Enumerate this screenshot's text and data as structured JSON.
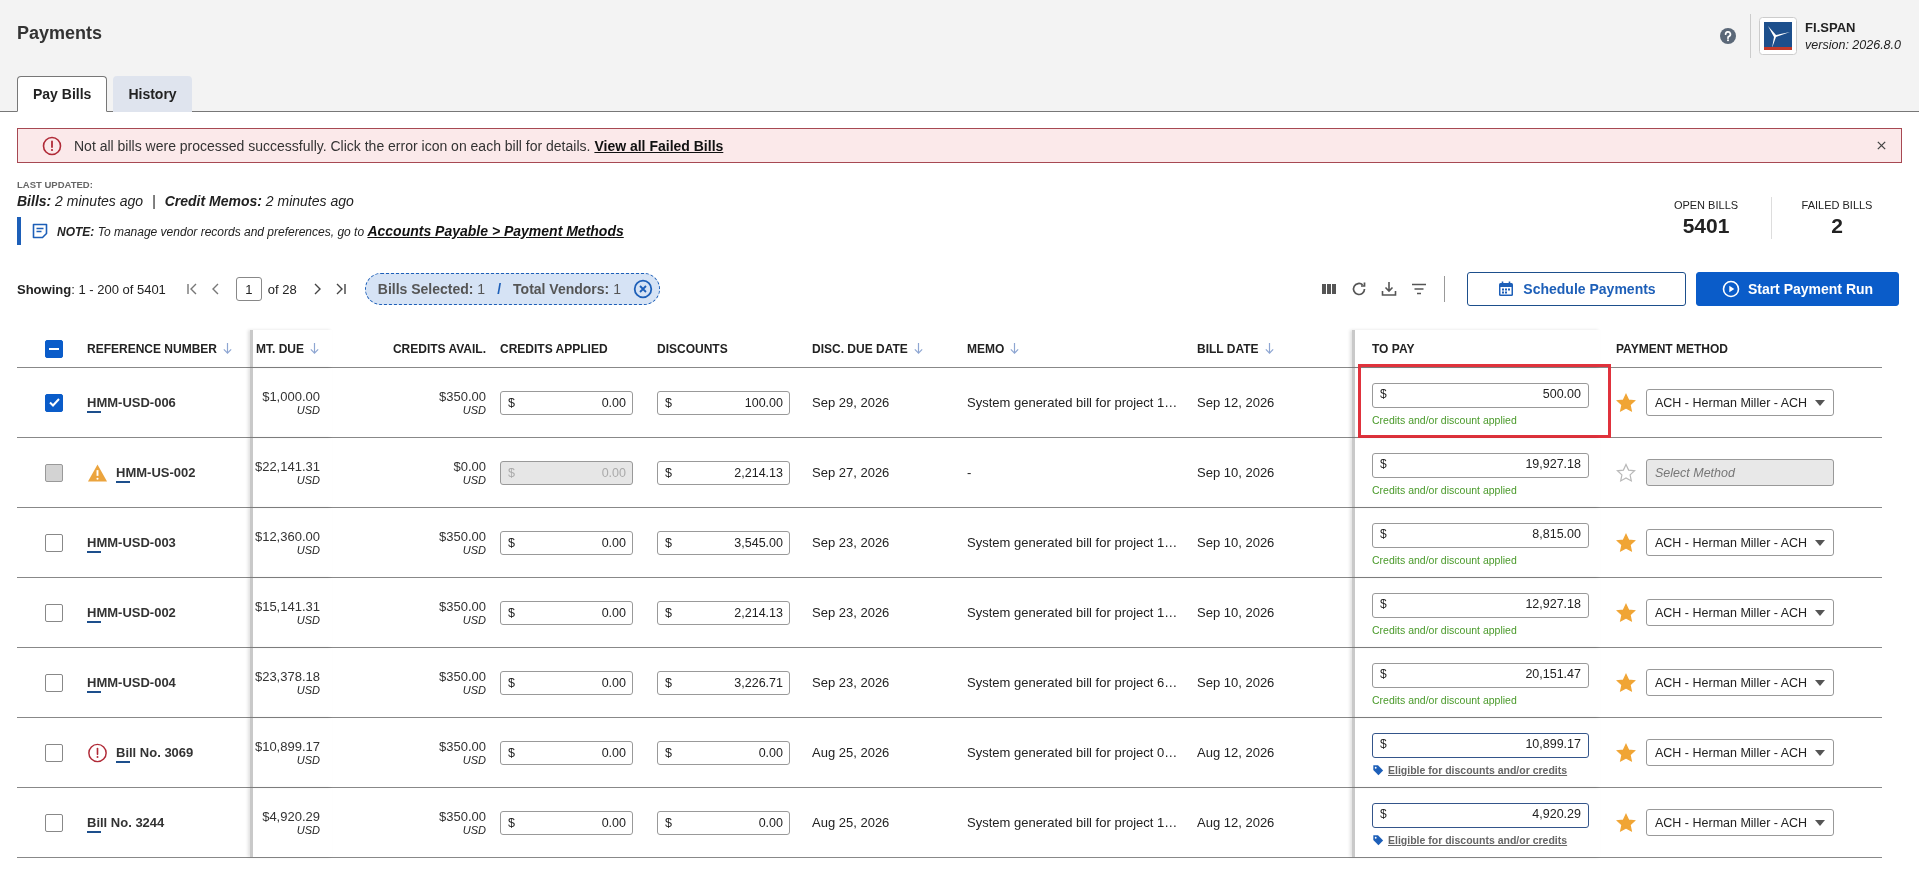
{
  "header": {
    "title": "Payments",
    "brand": {
      "name": "FI.SPAN",
      "version": "version: 2026.8.0"
    }
  },
  "tabs": [
    {
      "label": "Pay Bills",
      "selected": true
    },
    {
      "label": "History",
      "selected": false
    }
  ],
  "alert": {
    "message": "Not all bills were processed successfully. Click the error icon on each bill for details.",
    "link": "View all Failed Bills"
  },
  "last_updated": {
    "label": "LAST UPDATED:",
    "items": [
      {
        "label": "Bills:",
        "value": "2 minutes ago"
      },
      {
        "label": "Credit Memos:",
        "value": "2 minutes ago"
      }
    ],
    "separator": "|"
  },
  "note": {
    "label": "NOTE:",
    "text": "To manage vendor records and preferences, go to",
    "link": "Accounts Payable > Payment Methods"
  },
  "stats": [
    {
      "label": "OPEN BILLS",
      "value": "5401"
    },
    {
      "label": "FAILED BILLS",
      "value": "2"
    }
  ],
  "pagination": {
    "showing": "**Showing**: 1 - 200 of 5401",
    "page": "1",
    "of": "of 28"
  },
  "selection": {
    "items": [
      {
        "label": "Bills Selected:",
        "value": "1"
      },
      {
        "label": "Total Vendors:",
        "value": "1"
      }
    ],
    "separator": "/"
  },
  "actions": [
    {
      "label": "Schedule Payments",
      "kind": "secondary"
    },
    {
      "label": "Start Payment Run",
      "kind": "primary"
    }
  ],
  "table": {
    "select_all": {
      "indeterminate": true
    },
    "columns": [
      {
        "label": "REFERENCE NUMBER",
        "sortable": true
      },
      {
        "label": "MT. DUE",
        "sortable": true
      },
      {
        "label": "CREDITS AVAIL.",
        "sortable": false
      },
      {
        "label": "CREDITS APPLIED",
        "sortable": false
      },
      {
        "label": "DISCOUNTS",
        "sortable": false
      },
      {
        "label": "DISC. DUE DATE",
        "sortable": true
      },
      {
        "label": "MEMO",
        "sortable": true
      },
      {
        "label": "BILL DATE",
        "sortable": true
      },
      {
        "label": "TO PAY",
        "sortable": false
      },
      {
        "label": "PAYMENT METHOD",
        "sortable": false
      }
    ],
    "rows": [
      {
        "selected": true,
        "checkbox_disabled": false,
        "warning": false,
        "failed": false,
        "reference": "HMM-USD-006",
        "amount_due": "$1,000.00",
        "amount_currency": "USD",
        "credits_available": "$350.00",
        "credits_currency": "USD",
        "credits_applied": {
          "prefix": "$",
          "value": "0.00",
          "disabled": false
        },
        "discount": {
          "prefix": "$",
          "value": "100.00"
        },
        "disc_due_date": "Sep 29, 2026",
        "memo": "System generated bill for project 1…",
        "bill_date": "Sep 12, 2026",
        "to_pay": {
          "prefix": "$",
          "value": "500.00"
        },
        "to_pay_note": {
          "kind": "applied",
          "text": "Credits and/or discount applied"
        },
        "highlighted": true,
        "payment_method": {
          "favorite": true,
          "value": "ACH - Herman Miller - ACH",
          "disabled": false
        }
      },
      {
        "selected": false,
        "checkbox_disabled": true,
        "warning": true,
        "failed": false,
        "reference": "HMM-US-002",
        "amount_due": "$22,141.31",
        "amount_currency": "USD",
        "credits_available": "$0.00",
        "credits_currency": "USD",
        "credits_applied": {
          "prefix": "$",
          "value": "0.00",
          "disabled": true
        },
        "discount": {
          "prefix": "$",
          "value": "2,214.13"
        },
        "disc_due_date": "Sep 27, 2026",
        "memo": "-",
        "bill_date": "Sep 10, 2026",
        "to_pay": {
          "prefix": "$",
          "value": "19,927.18"
        },
        "to_pay_note": {
          "kind": "applied",
          "text": "Credits and/or discount applied"
        },
        "highlighted": false,
        "payment_method": {
          "favorite": false,
          "placeholder": "Select Method",
          "disabled": true
        }
      },
      {
        "selected": false,
        "checkbox_disabled": false,
        "warning": false,
        "failed": false,
        "reference": "HMM-USD-003",
        "amount_due": "$12,360.00",
        "amount_currency": "USD",
        "credits_available": "$350.00",
        "credits_currency": "USD",
        "credits_applied": {
          "prefix": "$",
          "value": "0.00",
          "disabled": false
        },
        "discount": {
          "prefix": "$",
          "value": "3,545.00"
        },
        "disc_due_date": "Sep 23, 2026",
        "memo": "System generated bill for project 1…",
        "bill_date": "Sep 10, 2026",
        "to_pay": {
          "prefix": "$",
          "value": "8,815.00"
        },
        "to_pay_note": {
          "kind": "applied",
          "text": "Credits and/or discount applied"
        },
        "highlighted": false,
        "payment_method": {
          "favorite": true,
          "value": "ACH - Herman Miller - ACH",
          "disabled": false
        }
      },
      {
        "selected": false,
        "checkbox_disabled": false,
        "warning": false,
        "failed": false,
        "reference": "HMM-USD-002",
        "amount_due": "$15,141.31",
        "amount_currency": "USD",
        "credits_available": "$350.00",
        "credits_currency": "USD",
        "credits_applied": {
          "prefix": "$",
          "value": "0.00",
          "disabled": false
        },
        "discount": {
          "prefix": "$",
          "value": "2,214.13"
        },
        "disc_due_date": "Sep 23, 2026",
        "memo": "System generated bill for project 1…",
        "bill_date": "Sep 10, 2026",
        "to_pay": {
          "prefix": "$",
          "value": "12,927.18"
        },
        "to_pay_note": {
          "kind": "applied",
          "text": "Credits and/or discount applied"
        },
        "highlighted": false,
        "payment_method": {
          "favorite": true,
          "value": "ACH - Herman Miller - ACH",
          "disabled": false
        }
      },
      {
        "selected": false,
        "checkbox_disabled": false,
        "warning": false,
        "failed": false,
        "reference": "HMM-USD-004",
        "amount_due": "$23,378.18",
        "amount_currency": "USD",
        "credits_available": "$350.00",
        "credits_currency": "USD",
        "credits_applied": {
          "prefix": "$",
          "value": "0.00",
          "disabled": false
        },
        "discount": {
          "prefix": "$",
          "value": "3,226.71"
        },
        "disc_due_date": "Sep 23, 2026",
        "memo": "System generated bill for project 6…",
        "bill_date": "Sep 10, 2026",
        "to_pay": {
          "prefix": "$",
          "value": "20,151.47"
        },
        "to_pay_note": {
          "kind": "applied",
          "text": "Credits and/or discount applied"
        },
        "highlighted": false,
        "payment_method": {
          "favorite": true,
          "value": "ACH - Herman Miller - ACH",
          "disabled": false
        }
      },
      {
        "selected": false,
        "checkbox_disabled": false,
        "warning": false,
        "failed": true,
        "reference": "Bill No. 3069",
        "amount_due": "$10,899.17",
        "amount_currency": "USD",
        "credits_available": "$350.00",
        "credits_currency": "USD",
        "credits_applied": {
          "prefix": "$",
          "value": "0.00",
          "disabled": false
        },
        "discount": {
          "prefix": "$",
          "value": "0.00"
        },
        "disc_due_date": "Aug 25, 2026",
        "memo": "System generated bill for project 0…",
        "bill_date": "Aug 12, 2026",
        "to_pay": {
          "prefix": "$",
          "value": "10,899.17"
        },
        "to_pay_note": {
          "kind": "eligible",
          "text": "Eligible for discounts and/or credits"
        },
        "highlighted": false,
        "payment_method": {
          "favorite": true,
          "value": "ACH - Herman Miller - ACH",
          "disabled": false
        }
      },
      {
        "selected": false,
        "checkbox_disabled": false,
        "warning": false,
        "failed": false,
        "reference": "Bill No. 3244",
        "amount_due": "$4,920.29",
        "amount_currency": "USD",
        "credits_available": "$350.00",
        "credits_currency": "USD",
        "credits_applied": {
          "prefix": "$",
          "value": "0.00",
          "disabled": false
        },
        "discount": {
          "prefix": "$",
          "value": "0.00"
        },
        "disc_due_date": "Aug 25, 2026",
        "memo": "System generated bill for project 1…",
        "bill_date": "Aug 12, 2026",
        "to_pay": {
          "prefix": "$",
          "value": "4,920.29"
        },
        "to_pay_note": {
          "kind": "eligible",
          "text": "Eligible for discounts and/or credits"
        },
        "highlighted": false,
        "payment_method": {
          "favorite": true,
          "value": "ACH - Herman Miller - ACH",
          "disabled": false
        }
      }
    ]
  }
}
